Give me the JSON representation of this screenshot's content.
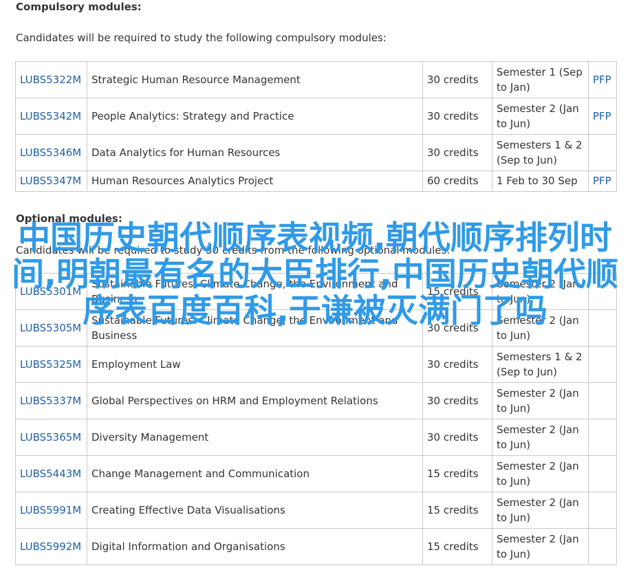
{
  "compulsory": {
    "heading": "Compulsory modules:",
    "intro": "Candidates will be required to study the following compulsory modules:",
    "rows": [
      {
        "code": "LUBS5322M",
        "title": "Strategic Human Resource Management",
        "credits": "30 credits",
        "semester": "Semester 1 (Sep to Jan)",
        "pfp": "PFP"
      },
      {
        "code": "LUBS5342M",
        "title": "People Analytics: Strategy and Practice",
        "credits": "30 credits",
        "semester": "Semester 2 (Jan to Jun)",
        "pfp": "PFP"
      },
      {
        "code": "LUBS5346M",
        "title": "Data Analytics for Human Resources",
        "credits": "30 credits",
        "semester": "Semesters 1 & 2 (Sep to Jun)",
        "pfp": ""
      },
      {
        "code": "LUBS5347M",
        "title": "Human Resources Analytics Project",
        "credits": "60 credits",
        "semester": "1 Feb to 30 Sep",
        "pfp": "PFP"
      }
    ]
  },
  "optional": {
    "heading": "Optional modules:",
    "intro": "Candidates will be required to study 30 credits from the following optional modules:",
    "rows": [
      {
        "code": "LUBS5301M",
        "title": "Sustainable Futures: Climate Change, the Environment and Business",
        "credits": "15 credits",
        "semester": "Semester 2 (Jan to Jun)",
        "pfp": ""
      },
      {
        "code": "LUBS5305M",
        "title": "Sustainable Futures: Climate Change, the Environment and Business",
        "credits": "30 credits",
        "semester": "Semester 2 (Jan to Jun)",
        "pfp": ""
      },
      {
        "code": "LUBS5325M",
        "title": "Employment Law",
        "credits": "30 credits",
        "semester": "Semesters 1 & 2 (Sep to Jun)",
        "pfp": ""
      },
      {
        "code": "LUBS5337M",
        "title": "Global Perspectives on HRM and Employment Relations",
        "credits": "30 credits",
        "semester": "Semester 2 (Jan to Jun)",
        "pfp": ""
      },
      {
        "code": "LUBS5365M",
        "title": "Diversity Management",
        "credits": "30 credits",
        "semester": "Semester 2 (Jan to Jun)",
        "pfp": ""
      },
      {
        "code": "LUBS5443M",
        "title": "Change Management and Communication",
        "credits": "15 credits",
        "semester": "Semester 2 (Jan to Jun)",
        "pfp": ""
      },
      {
        "code": "LUBS5991M",
        "title": "Creating Effective Data Visualisations",
        "credits": "15 credits",
        "semester": "Semester 2 (Jan to Jun)",
        "pfp": ""
      },
      {
        "code": "LUBS5992M",
        "title": "Digital Information and Organisations",
        "credits": "15 credits",
        "semester": "Semester 2 (Jan to Jun)",
        "pfp": ""
      }
    ]
  },
  "overlay_text": "中国历史朝代顺序表视频,朝代顺序排列时间,明朝最有名的大臣排行,中国历史朝代顺序表百度百科,于谦被灭满门了吗",
  "colors": {
    "link": "#1f5fa8",
    "overlay": "#2f9ae8",
    "border": "#c8c8c8"
  }
}
